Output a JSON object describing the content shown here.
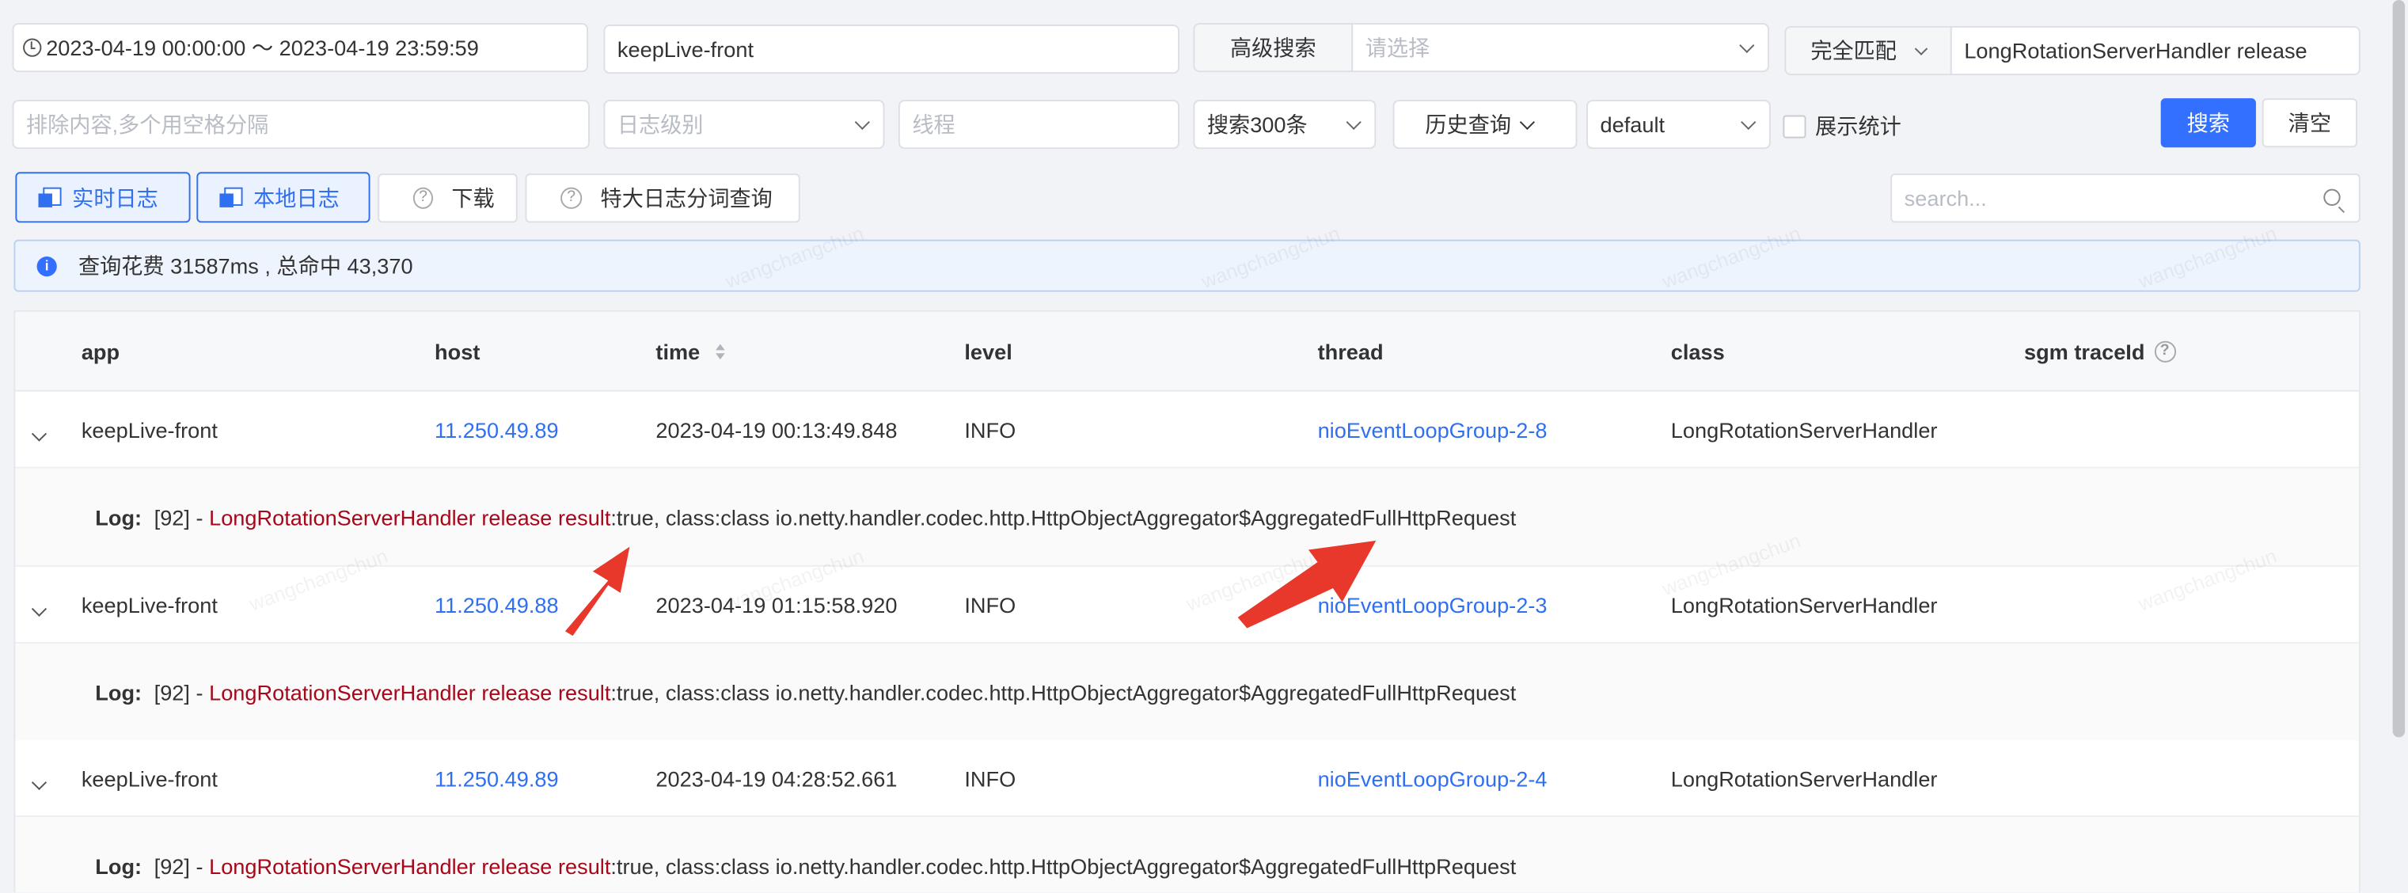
{
  "filters": {
    "date_range": "2023-04-19 00:00:00 ～ 2023-04-19 23:59:59",
    "app_value": "keepLive-front",
    "advanced_search_label": "高级搜索",
    "advanced_search_placeholder": "请选择",
    "match_mode": "完全匹配",
    "keyword_value": "LongRotationServerHandler release",
    "exclude_placeholder": "排除内容,多个用空格分隔",
    "log_level_placeholder": "日志级别",
    "thread_placeholder": "线程",
    "result_count": "搜索300条",
    "history_label": "历史查询",
    "env_value": "default",
    "show_stats_label": "展示统计",
    "search_button": "搜索",
    "clear_button": "清空"
  },
  "toolbar": {
    "realtime_log": "实时日志",
    "local_log": "本地日志",
    "download": "下载",
    "big_log_query": "特大日志分词查询",
    "search_placeholder": "search..."
  },
  "info": {
    "message": "查询花费 31587ms , 总命中 43,370"
  },
  "table": {
    "columns": [
      "app",
      "host",
      "time",
      "level",
      "thread",
      "class",
      "sgm traceId"
    ],
    "log_label": "Log:",
    "rows": [
      {
        "app": "keepLive-front",
        "host": "11.250.49.89",
        "time": "2023-04-19 00:13:49.848",
        "level": "INFO",
        "thread": "nioEventLoopGroup-2-8",
        "class": "LongRotationServerHandler",
        "log_prefix": "[92] - ",
        "log_highlight": "LongRotationServerHandler release result",
        "log_rest": ":true, class:class io.netty.handler.codec.http.HttpObjectAggregator$AggregatedFullHttpRequest"
      },
      {
        "app": "keepLive-front",
        "host": "11.250.49.88",
        "time": "2023-04-19 01:15:58.920",
        "level": "INFO",
        "thread": "nioEventLoopGroup-2-3",
        "class": "LongRotationServerHandler",
        "log_prefix": "[92] - ",
        "log_highlight": "LongRotationServerHandler release result",
        "log_rest": ":true, class:class io.netty.handler.codec.http.HttpObjectAggregator$AggregatedFullHttpRequest"
      },
      {
        "app": "keepLive-front",
        "host": "11.250.49.89",
        "time": "2023-04-19 04:28:52.661",
        "level": "INFO",
        "thread": "nioEventLoopGroup-2-4",
        "class": "LongRotationServerHandler",
        "log_prefix": "[92] - ",
        "log_highlight": "LongRotationServerHandler release result",
        "log_rest": ":true, class:class io.netty.handler.codec.http.HttpObjectAggregator$AggregatedFullHttpRequest"
      }
    ]
  },
  "colors": {
    "primary": "#3370ff",
    "link": "#2f6ff0",
    "highlight": "#a8071a",
    "annotation_arrow": "#e8382b"
  },
  "watermark_text": "wangchangchun"
}
